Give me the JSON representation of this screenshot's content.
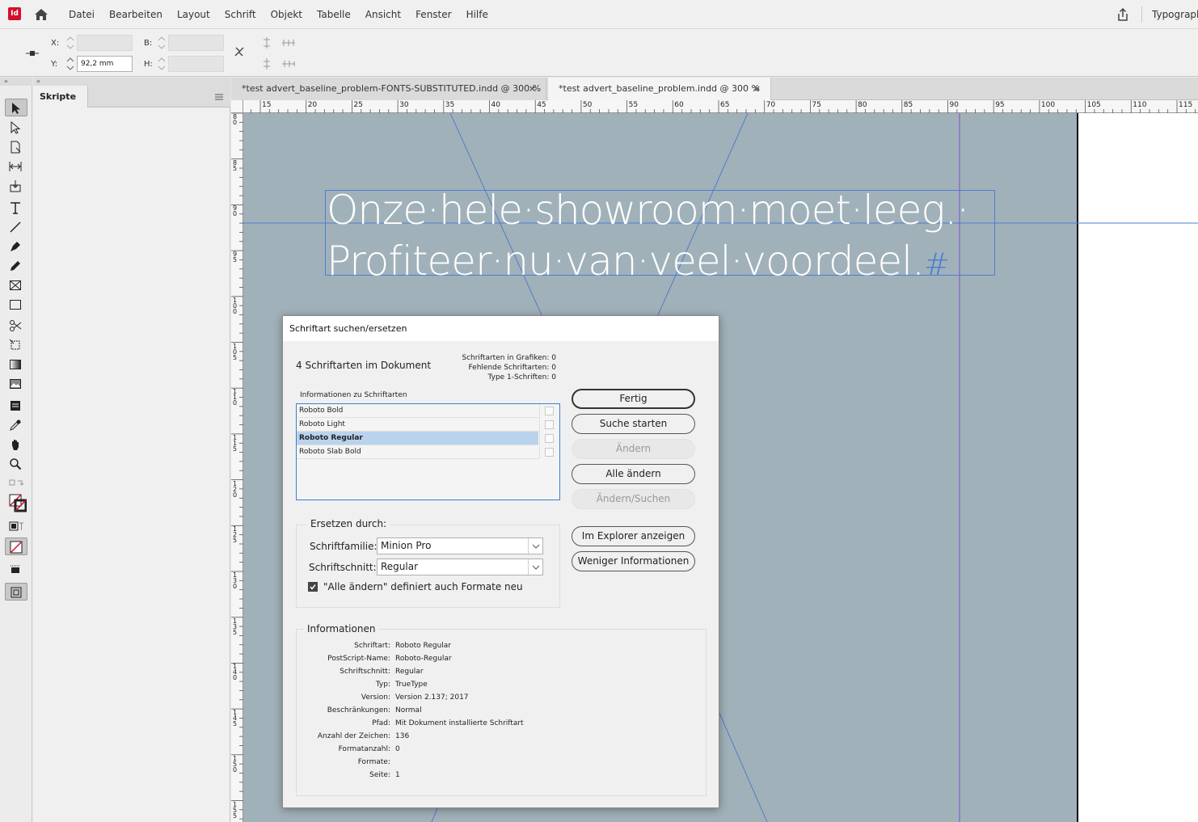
{
  "app": {
    "logo": "Id",
    "menus": [
      "Datei",
      "Bearbeiten",
      "Layout",
      "Schrift",
      "Objekt",
      "Tabelle",
      "Ansicht",
      "Fenster",
      "Hilfe"
    ],
    "workspace": "Typograph"
  },
  "control_bar": {
    "x_label": "X:",
    "y_label": "Y:",
    "w_label": "B:",
    "h_label": "H:",
    "x_value": "",
    "y_value": "92,2 mm",
    "w_value": "",
    "h_value": ""
  },
  "panels": {
    "collapse_left": "»",
    "collapse_right": "«",
    "scripts_tab": "Skripte"
  },
  "document": {
    "tabs": [
      {
        "label": "*test advert_baseline_problem-FONTS-SUBSTITUTED.indd @ 300 %",
        "close": "×"
      },
      {
        "label": "*test advert_baseline_problem.indd @ 300 %",
        "close": "×"
      }
    ],
    "ruler_h": [
      "15",
      "20",
      "25",
      "30",
      "35",
      "40",
      "45",
      "50",
      "55",
      "60",
      "65",
      "70",
      "75",
      "80",
      "85",
      "90",
      "95",
      "100",
      "105",
      "110",
      "115"
    ],
    "ruler_v": [
      "80",
      "85",
      "90",
      "95",
      "100",
      "105",
      "110",
      "115",
      "120",
      "125",
      "130",
      "135",
      "140",
      "145",
      "150",
      "155"
    ],
    "headline_line1": "Onze·hele·showroom·moet·leeg.·",
    "headline_line2": "Profiteer·nu·van·veel·voordeel.",
    "headline_end_mark": "#"
  },
  "dialog": {
    "title": "Schriftart suchen/ersetzen",
    "font_count": "4 Schriftarten im Dokument",
    "stats": [
      "Schriftarten in Grafiken: 0",
      "Fehlende Schriftarten: 0",
      "Type 1-Schriften: 0"
    ],
    "font_list_label": "Informationen zu Schriftarten",
    "fonts": [
      {
        "name": "Roboto Bold",
        "selected": false
      },
      {
        "name": "Roboto Light",
        "selected": false
      },
      {
        "name": "Roboto Regular",
        "selected": true
      },
      {
        "name": "Roboto Slab Bold",
        "selected": false
      }
    ],
    "buttons": {
      "done": "Fertig",
      "find": "Suche starten",
      "change": "Ändern",
      "change_all": "Alle ändern",
      "change_find": "Ändern/Suchen",
      "reveal": "Im Explorer anzeigen",
      "less_info": "Weniger Informationen"
    },
    "replace": {
      "group_label": "Ersetzen durch:",
      "family_label": "Schriftfamilie:",
      "family_value": "Minion Pro",
      "style_label": "Schriftschnitt:",
      "style_value": "Regular",
      "redefine_label": "\"Alle ändern\" definiert auch Formate neu",
      "redefine_checked": true
    },
    "info": {
      "group_label": "Informationen",
      "rows": [
        {
          "key": "Schriftart:",
          "value": "Roboto Regular"
        },
        {
          "key": "PostScript-Name:",
          "value": "Roboto-Regular"
        },
        {
          "key": "Schriftschnitt:",
          "value": "Regular"
        },
        {
          "key": "Typ:",
          "value": "TrueType"
        },
        {
          "key": "Version:",
          "value": "Version 2.137; 2017"
        },
        {
          "key": "Beschränkungen:",
          "value": "Normal"
        },
        {
          "key": "Pfad:",
          "value": "Mit Dokument installierte Schriftart"
        },
        {
          "key": "Anzahl der Zeichen:",
          "value": "136"
        },
        {
          "key": "Formatanzahl:",
          "value": "0"
        },
        {
          "key": "Formate:",
          "value": ""
        },
        {
          "key": "Seite:",
          "value": "1"
        }
      ]
    }
  },
  "colors": {
    "canvas": "#a1b1b9",
    "guide": "#4a7fd4",
    "column_guide": "#7a4fd0",
    "selection": "#b9d3ee",
    "app_brand": "#d0112b"
  }
}
